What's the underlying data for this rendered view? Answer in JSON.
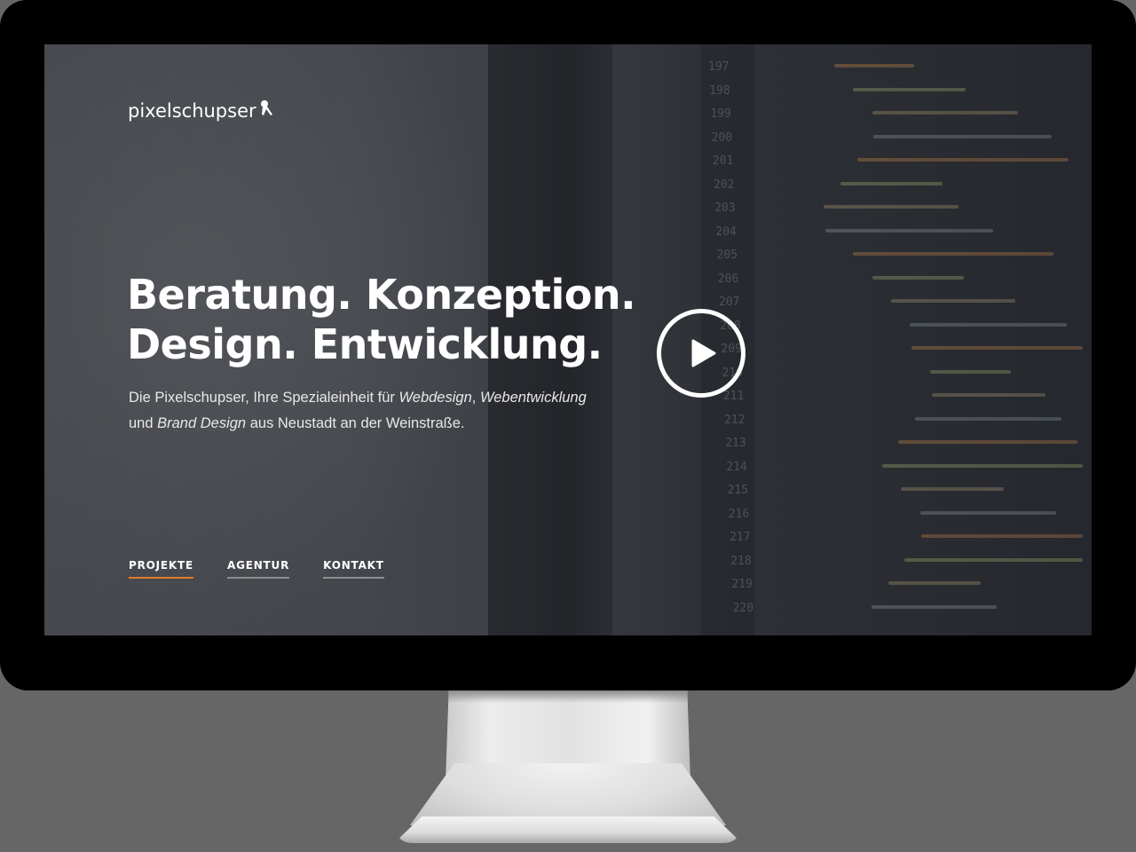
{
  "brand": {
    "logo_text": "pixelschupser",
    "logo_icon": "pushpin-hand-icon"
  },
  "hero": {
    "headline_line1": "Beratung. Konzeption.",
    "headline_line2": "Design. Entwicklung.",
    "sub_part1": "Die Pixelschupser, Ihre Spezialeinheit für ",
    "sub_em1": "Webdesign",
    "sub_part2": ", ",
    "sub_em2": "Webentwicklung",
    "sub_part3": "und ",
    "sub_em3": "Brand Design",
    "sub_part4": " aus Neustadt an der Weinstraße."
  },
  "video": {
    "play_icon": "play-icon"
  },
  "nav": {
    "items": [
      {
        "label": "PROJEKTE",
        "active": true
      },
      {
        "label": "AGENTUR",
        "active": false
      },
      {
        "label": "KONTAKT",
        "active": false
      }
    ]
  },
  "background_code": {
    "line_numbers": [
      "197",
      "198",
      "199",
      "200",
      "201",
      "202",
      "203",
      "204",
      "205",
      "206",
      "207",
      "208",
      "209",
      "210",
      "211",
      "212",
      "213",
      "214",
      "215",
      "216",
      "217",
      "218",
      "219",
      "220"
    ]
  },
  "colors": {
    "accent": "#e07b2a",
    "text": "#ffffff",
    "bezel": "#000000",
    "background": "#666666"
  }
}
